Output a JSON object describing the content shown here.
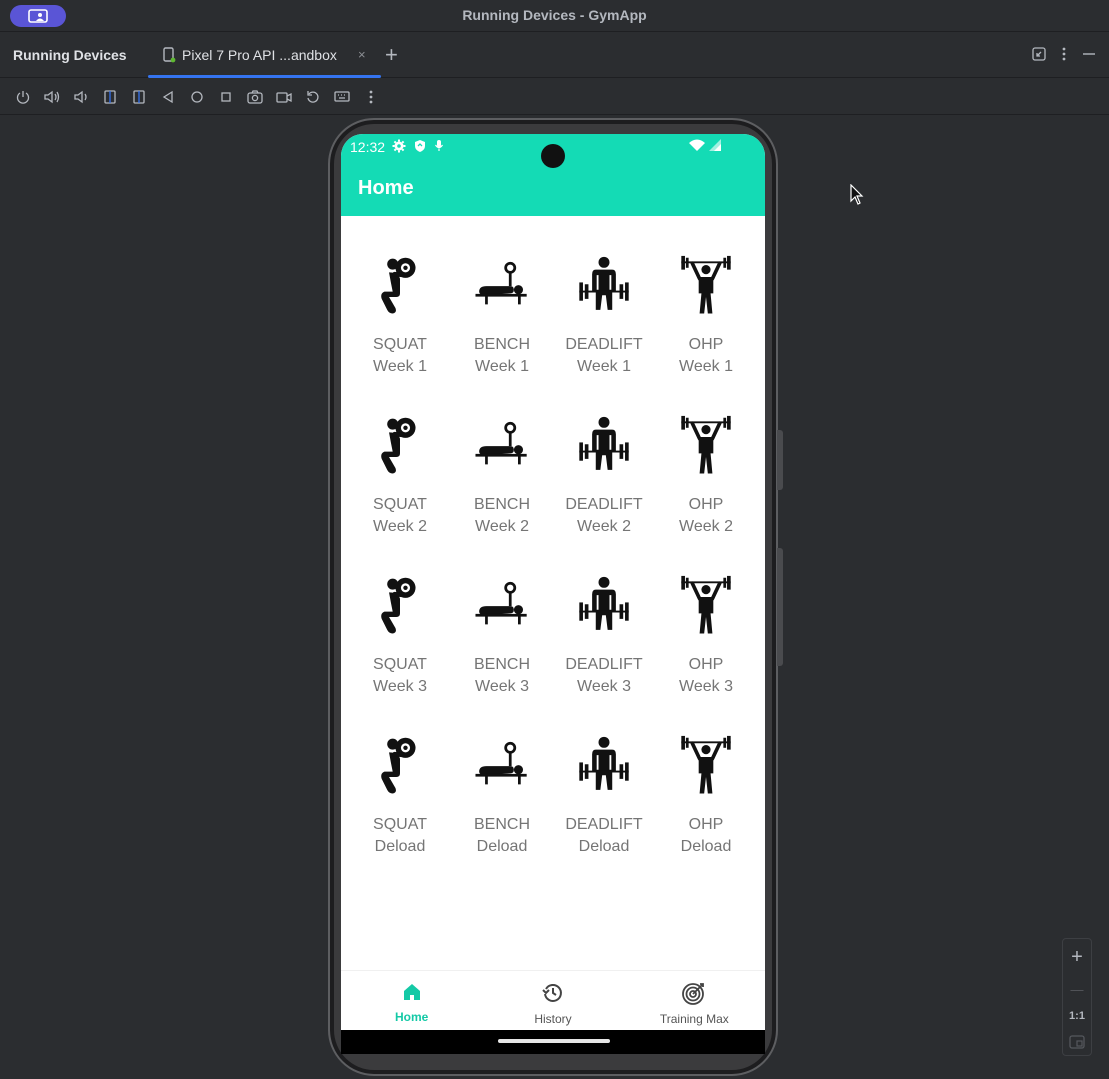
{
  "window": {
    "title": "Running Devices - GymApp"
  },
  "toolwindow": {
    "title": "Running Devices",
    "tab_label": "Pixel 7 Pro API ...andbox",
    "tab_close": "×",
    "add_tab": "+"
  },
  "toolbar": {
    "icons": [
      "power-icon",
      "volume-up-icon",
      "volume-down-icon",
      "rotate-left-icon",
      "rotate-right-icon",
      "back-icon",
      "home-icon",
      "overview-icon",
      "screenshot-icon",
      "screen-record-icon",
      "reset-icon",
      "keyboard-icon",
      "more-icon"
    ]
  },
  "phone": {
    "status": {
      "time": "12:32"
    },
    "appbar": {
      "title": "Home",
      "color": "#14dbb5"
    },
    "rows": [
      [
        {
          "lift": "SQUAT",
          "week": "Week 1",
          "icon": "squat"
        },
        {
          "lift": "BENCH",
          "week": "Week 1",
          "icon": "bench"
        },
        {
          "lift": "DEADLIFT",
          "week": "Week 1",
          "icon": "deadlift"
        },
        {
          "lift": "OHP",
          "week": "Week 1",
          "icon": "ohp"
        }
      ],
      [
        {
          "lift": "SQUAT",
          "week": "Week 2",
          "icon": "squat"
        },
        {
          "lift": "BENCH",
          "week": "Week 2",
          "icon": "bench"
        },
        {
          "lift": "DEADLIFT",
          "week": "Week 2",
          "icon": "deadlift"
        },
        {
          "lift": "OHP",
          "week": "Week 2",
          "icon": "ohp"
        }
      ],
      [
        {
          "lift": "SQUAT",
          "week": "Week 3",
          "icon": "squat"
        },
        {
          "lift": "BENCH",
          "week": "Week 3",
          "icon": "bench"
        },
        {
          "lift": "DEADLIFT",
          "week": "Week 3",
          "icon": "deadlift"
        },
        {
          "lift": "OHP",
          "week": "Week 3",
          "icon": "ohp"
        }
      ],
      [
        {
          "lift": "SQUAT",
          "week": "Deload",
          "icon": "squat"
        },
        {
          "lift": "BENCH",
          "week": "Deload",
          "icon": "bench"
        },
        {
          "lift": "DEADLIFT",
          "week": "Deload",
          "icon": "deadlift"
        },
        {
          "lift": "OHP",
          "week": "Deload",
          "icon": "ohp"
        }
      ]
    ],
    "nav": [
      {
        "label": "Home",
        "icon": "home-icon",
        "active": true
      },
      {
        "label": "History",
        "icon": "history-icon",
        "active": false
      },
      {
        "label": "Training Max",
        "icon": "target-icon",
        "active": false
      }
    ]
  },
  "zoom": {
    "plus": "+",
    "minus": "—",
    "actual": "1:1"
  }
}
